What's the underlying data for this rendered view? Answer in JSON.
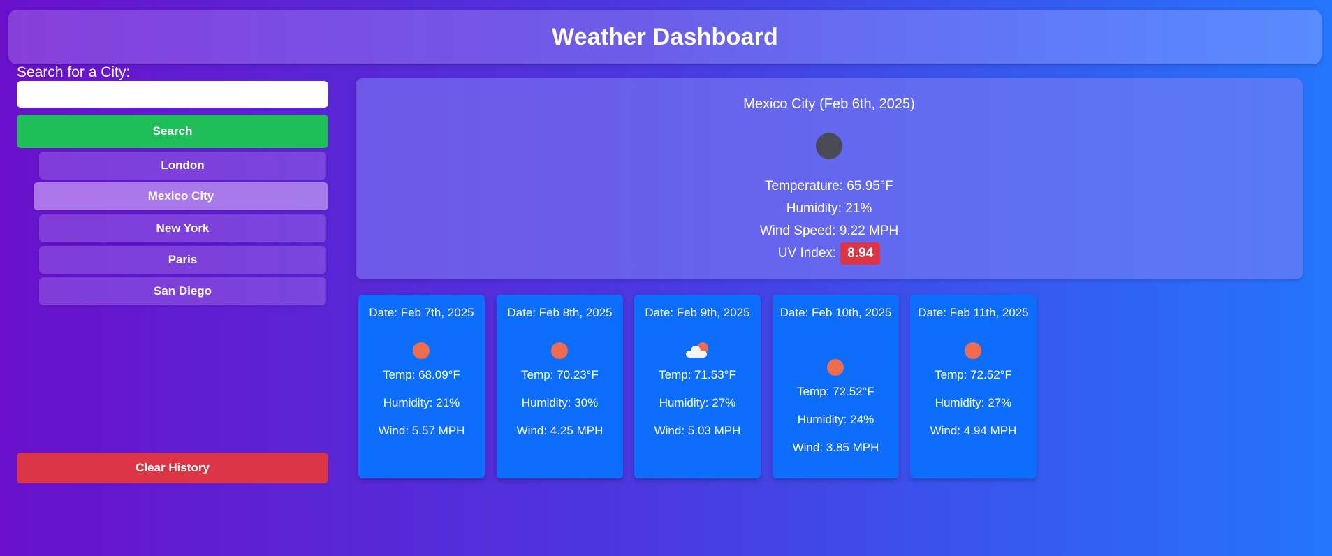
{
  "header": {
    "title": "Weather Dashboard"
  },
  "sidebar": {
    "search_label": "Search for a City:",
    "search_value": "",
    "search_button": "Search",
    "history": [
      "London",
      "Mexico City",
      "New York",
      "Paris",
      "San Diego"
    ],
    "active_history": "Mexico City",
    "clear_button": "Clear History"
  },
  "current": {
    "city_date": "Mexico City (Feb 6th, 2025)",
    "icon": "dark-circle-icon",
    "temperature": "Temperature: 65.95°F",
    "humidity": "Humidity: 21%",
    "wind": "Wind Speed: 9.22 MPH",
    "uv_label": "UV Index:",
    "uv_value": "8.94"
  },
  "forecast": [
    {
      "date": "Date: Feb 7th, 2025",
      "icon": "sun-icon",
      "temp": "Temp: 68.09°F",
      "humidity": "Humidity: 21%",
      "wind": "Wind: 5.57 MPH"
    },
    {
      "date": "Date: Feb 8th, 2025",
      "icon": "sun-icon",
      "temp": "Temp: 70.23°F",
      "humidity": "Humidity: 30%",
      "wind": "Wind: 4.25 MPH"
    },
    {
      "date": "Date: Feb 9th, 2025",
      "icon": "partly-cloudy-icon",
      "temp": "Temp: 71.53°F",
      "humidity": "Humidity: 27%",
      "wind": "Wind: 5.03 MPH"
    },
    {
      "date": "Date: Feb 10th, 2025",
      "icon": "sun-icon",
      "temp": "Temp: 72.52°F",
      "humidity": "Humidity: 24%",
      "wind": "Wind: 3.85 MPH"
    },
    {
      "date": "Date: Feb 11th, 2025",
      "icon": "sun-icon",
      "temp": "Temp: 72.52°F",
      "humidity": "Humidity: 27%",
      "wind": "Wind: 4.94 MPH"
    }
  ],
  "colors": {
    "search_button": "#1fbe59",
    "clear_button": "#dc3545",
    "uv_badge": "#dc3545",
    "forecast_card": "#0d6efd",
    "sun_icon": "#ef6c4e"
  }
}
